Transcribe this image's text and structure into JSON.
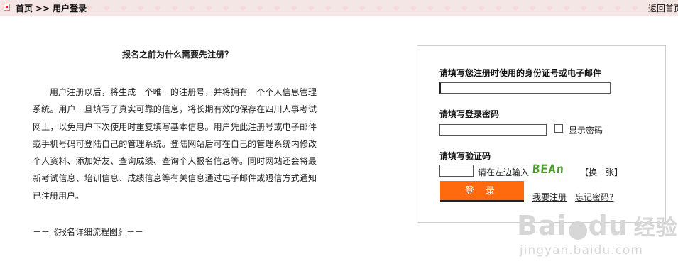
{
  "breadcrumb": {
    "home": "首页",
    "separator": ">>",
    "current": "用户登录",
    "back_home": "返回首页"
  },
  "info": {
    "title": "报名之前为什么需要先注册？",
    "paragraph": "用户注册以后，将生成一个唯一的注册号，并将拥有一个个人信息管理系统。用户一旦填写了真实可靠的信息，将长期有效的保存在四川人事考试网上，以免用户下次使用时重复填写基本信息。用户凭此注册号或电子邮件或手机号码可登陆自己的管理系统。登陆网站后可在自己的管理系统内修改个人资料、添加好友、查询成绩、查询个人报名信息等。同时网站还会将最新考试信息、培训信息、成绩信息等有关信息通过电子邮件或短信方式通知已注册用户。",
    "flow_prefix": "－－",
    "flow_link": "《报名详细流程图》",
    "flow_suffix": "－－"
  },
  "login": {
    "id_label": "请填写您注册时使用的身份证号或电子邮件",
    "id_value": "",
    "password_label": "请填写登录密码",
    "password_value": "",
    "show_password_label": "显示密码",
    "show_password_checked": false,
    "captcha_label": "请填写验证码",
    "captcha_value": "",
    "captcha_hint": "请在左边输入",
    "captcha_image_text": "BEAn",
    "refresh_captcha": "【换一张】",
    "submit_label": "登 录",
    "register_link": "我要注册",
    "forgot_link": "忘记密码?"
  },
  "watermark": {
    "logo_left": "Bai",
    "logo_right": "du",
    "logo_cn": "经验",
    "url": "jingyan.baidu.com"
  },
  "colors": {
    "submit_button": "#ff6a0e",
    "captcha_text": "#4d9a2a",
    "topbar_bg": "#f4e6e4"
  }
}
